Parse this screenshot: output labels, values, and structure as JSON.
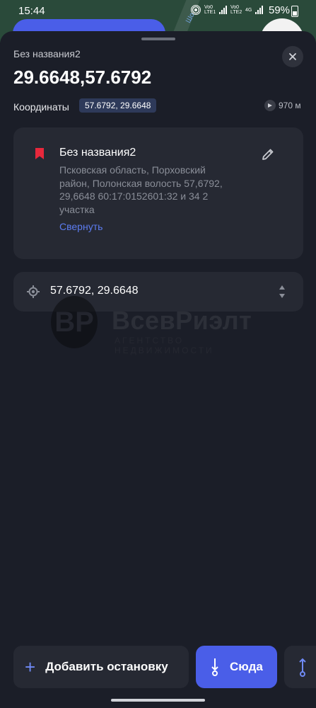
{
  "status_bar": {
    "time": "15:44",
    "sim1": "Vo0 LTE1",
    "sim2": "Vo0 LTE2",
    "network": "4G",
    "battery": "59%"
  },
  "map": {
    "street_label": "Шо"
  },
  "sheet": {
    "place_title": "Без названия2",
    "coords_big": "29.6648,57.6792",
    "coords_label": "Координаты",
    "coords_chip": "57.6792, 29.6648",
    "distance": "970 м",
    "close_icon": "close-icon"
  },
  "card": {
    "title": "Без названия2",
    "address": "Псковская область, Порховский район, Полонская волость 57,6792, 29,6648 60:17:0152601:32 и 34   2 участка",
    "collapse_label": "Свернуть",
    "bookmark_color": "#e8283c"
  },
  "coord_row": {
    "value": "57.6792, 29.6648"
  },
  "watermark": {
    "logo_text": "ВР",
    "brand": "ВсевРиэлт",
    "tagline": "АГЕНТСТВО НЕДВИЖИМОСТИ"
  },
  "bottom": {
    "add_stop_label": "Добавить остановку",
    "here_label": "Сюда"
  },
  "colors": {
    "accent": "#4a5ee8",
    "link": "#5c7cf0"
  }
}
